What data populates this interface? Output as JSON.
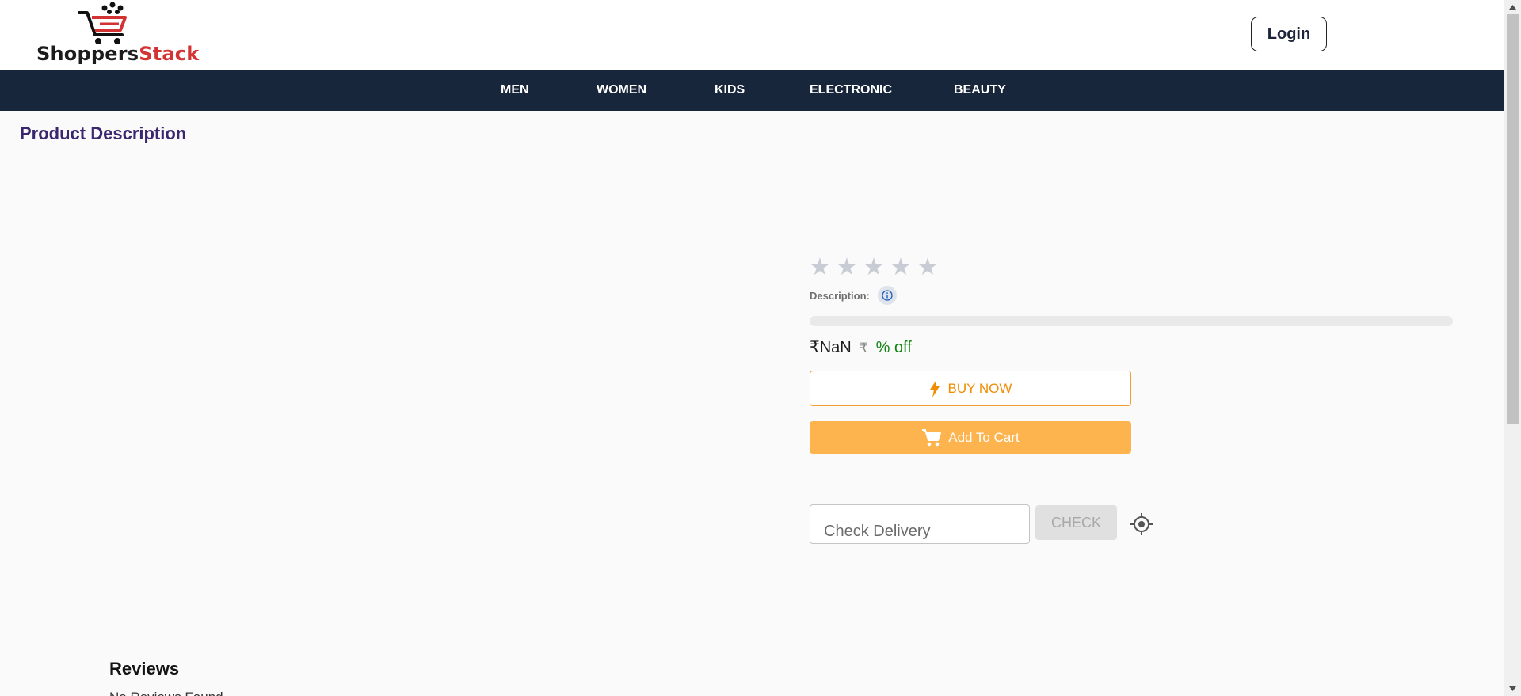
{
  "header": {
    "logo_text_dark": "Shoppers",
    "logo_text_accent": "Stack",
    "login_label": "Login"
  },
  "nav": {
    "items": [
      {
        "label": "MEN"
      },
      {
        "label": "WOMEN"
      },
      {
        "label": "KIDS"
      },
      {
        "label": "ELECTRONIC"
      },
      {
        "label": "BEAUTY"
      }
    ]
  },
  "product": {
    "section_title": "Product Description",
    "rating": {
      "value": 0,
      "max": 5
    },
    "description_label": "Description:",
    "price": "₹NaN",
    "original_price": "₹",
    "discount": "% off",
    "buy_now_label": "BUY NOW",
    "add_to_cart_label": "Add To Cart"
  },
  "delivery": {
    "placeholder": "Check Delivery",
    "check_label": "CHECK"
  },
  "reviews": {
    "title": "Reviews",
    "empty_text": "No Reviews Found"
  },
  "colors": {
    "nav_background": "#18263b",
    "title_color": "#3b2770",
    "buy_now_accent": "#f08c00",
    "add_to_cart_background": "#fdb44e",
    "discount_color": "#148414",
    "logo_accent": "#d43333"
  },
  "icons": {
    "logo": "shopping-cart-icon",
    "rating": "star-icon",
    "info": "info-icon",
    "buy": "lightning-bolt-icon",
    "cart": "shopping-cart-icon",
    "locate": "gps-crosshair-icon"
  }
}
